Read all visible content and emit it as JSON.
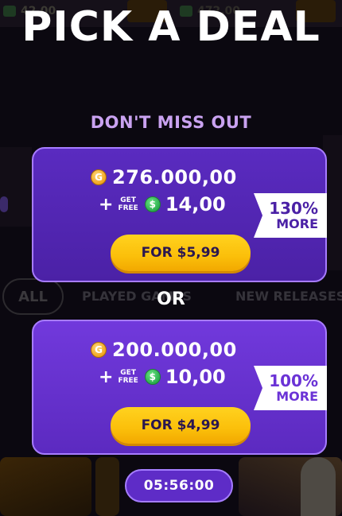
{
  "background": {
    "balance_left": "42,00",
    "balance_right": "472,00",
    "tabs": [
      {
        "label": "ALL"
      },
      {
        "label": "PLAYED GAMES"
      },
      {
        "label": "NEW RELEASES"
      }
    ]
  },
  "overlay": {
    "title": "PICK A DEAL",
    "subtitle": "DON'T MISS OUT",
    "or_label": "OR",
    "timer": "05:56:00"
  },
  "deals": [
    {
      "coins": "276.000,00",
      "get_free_top": "GET",
      "get_free_bottom": "FREE",
      "cash": "14,00",
      "badge_percent": "130%",
      "badge_more": "MORE",
      "button_label": "FOR $5,99"
    },
    {
      "coins": "200.000,00",
      "get_free_top": "GET",
      "get_free_bottom": "FREE",
      "cash": "10,00",
      "badge_percent": "100%",
      "badge_more": "MORE",
      "button_label": "FOR $4,99"
    }
  ],
  "icons": {
    "coin_glyph": "G",
    "cash_glyph": "$",
    "plus": "+"
  },
  "colors": {
    "deal_primary": "#4b21a6",
    "deal_secondary": "#6b33d6",
    "button_yellow": "#fbbf0a",
    "subtitle_lilac": "#c9a2f0"
  }
}
